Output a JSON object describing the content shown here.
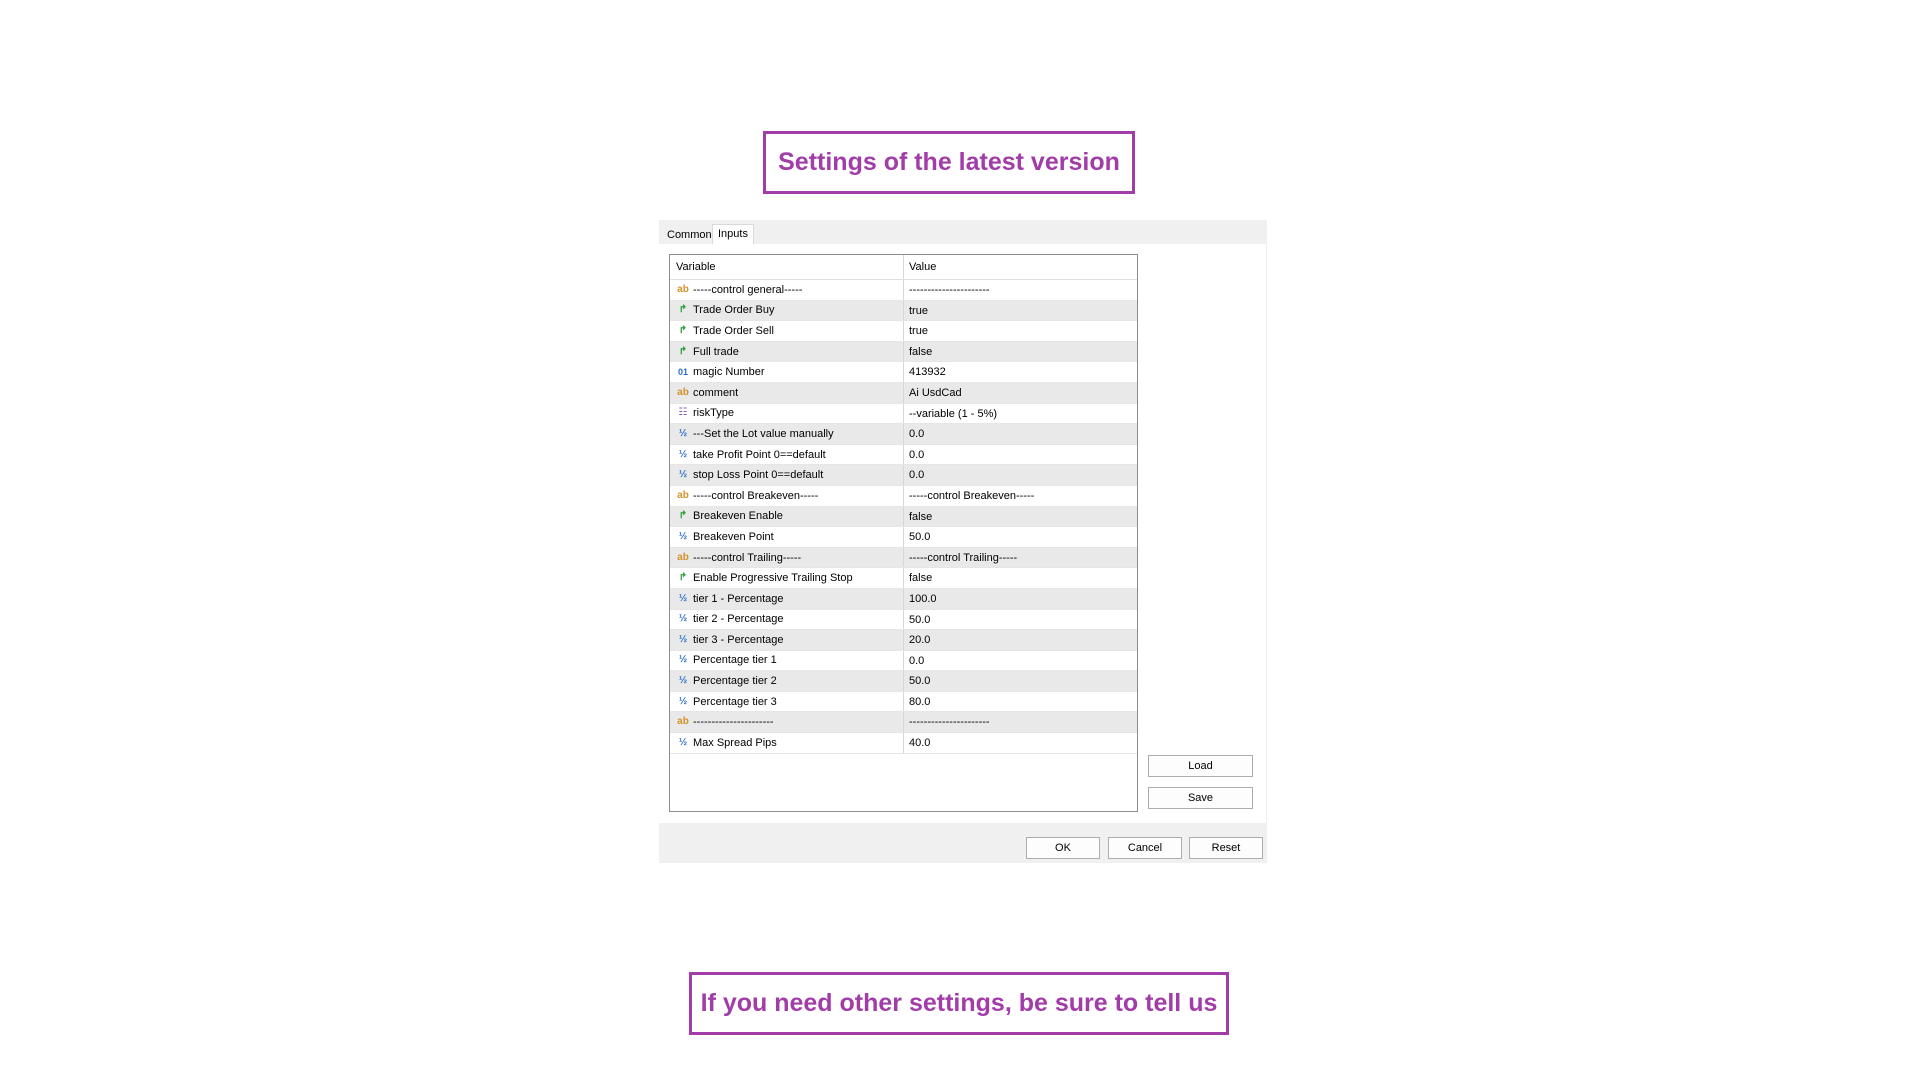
{
  "banners": {
    "top": "Settings of the latest version",
    "bottom": "If you need other settings, be sure to tell us"
  },
  "tabs": [
    "Common",
    "Inputs"
  ],
  "active_tab": "Inputs",
  "grid": {
    "headers": {
      "variable": "Variable",
      "value": "Value"
    },
    "rows": [
      {
        "icon": "string-icon",
        "variable": "-----control general-----",
        "value": "----------------------"
      },
      {
        "icon": "bool-icon",
        "variable": "Trade Order Buy",
        "value": "true"
      },
      {
        "icon": "bool-icon",
        "variable": "Trade Order Sell",
        "value": "true"
      },
      {
        "icon": "bool-icon",
        "variable": "Full trade",
        "value": "false"
      },
      {
        "icon": "int-icon",
        "variable": "magic Number",
        "value": "413932"
      },
      {
        "icon": "string-icon",
        "variable": "comment",
        "value": "Ai UsdCad"
      },
      {
        "icon": "enum-icon",
        "variable": "riskType",
        "value": "--variable (1 - 5%)"
      },
      {
        "icon": "double-icon",
        "variable": "---Set the Lot value manually",
        "value": "0.0"
      },
      {
        "icon": "double-icon",
        "variable": "take Profit Point 0==default",
        "value": "0.0"
      },
      {
        "icon": "double-icon",
        "variable": "stop Loss Point  0==default",
        "value": "0.0"
      },
      {
        "icon": "string-icon",
        "variable": "-----control Breakeven-----",
        "value": "-----control Breakeven-----"
      },
      {
        "icon": "bool-icon",
        "variable": "Breakeven Enable",
        "value": "false"
      },
      {
        "icon": "double-icon",
        "variable": "Breakeven Point",
        "value": "50.0"
      },
      {
        "icon": "string-icon",
        "variable": "-----control Trailing-----",
        "value": "-----control Trailing-----"
      },
      {
        "icon": "bool-icon",
        "variable": "Enable Progressive Trailing Stop",
        "value": "false"
      },
      {
        "icon": "double-icon",
        "variable": "tier 1 - Percentage",
        "value": "100.0"
      },
      {
        "icon": "double-icon",
        "variable": "tier 2 - Percentage",
        "value": "50.0"
      },
      {
        "icon": "double-icon",
        "variable": "tier 3 - Percentage",
        "value": "20.0"
      },
      {
        "icon": "double-icon",
        "variable": "Percentage tier 1",
        "value": "0.0"
      },
      {
        "icon": "double-icon",
        "variable": "Percentage tier 2",
        "value": "50.0"
      },
      {
        "icon": "double-icon",
        "variable": "Percentage tier 3",
        "value": "80.0"
      },
      {
        "icon": "string-icon",
        "variable": "----------------------",
        "value": "----------------------"
      },
      {
        "icon": "double-icon",
        "variable": "Max Spread Pips",
        "value": "40.0"
      }
    ]
  },
  "side_buttons": {
    "load": "Load",
    "save": "Save"
  },
  "footer_buttons": {
    "ok": "OK",
    "cancel": "Cancel",
    "reset": "Reset"
  },
  "colors": {
    "accent": "#a23ca8"
  }
}
